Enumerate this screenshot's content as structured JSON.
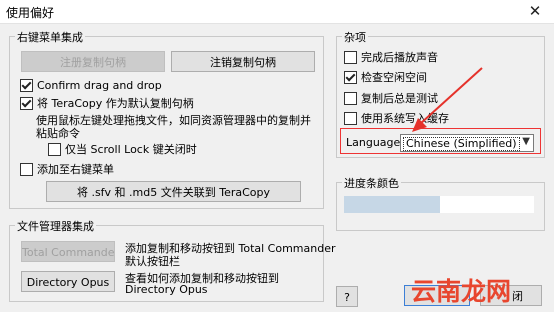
{
  "window": {
    "title": "使用偏好",
    "close_glyph": "✕"
  },
  "left": {
    "context_group": {
      "title": "右键菜单集成",
      "register_button": "注册复制句柄",
      "unregister_button": "注销复制句柄",
      "confirm_drag_label": "Confirm drag and drop",
      "confirm_drag_checked": true,
      "default_handler_label": "将 TeraCopy 作为默认复制句柄",
      "default_handler_checked": true,
      "default_handler_desc_1": "使用鼠标左键处理拖拽文件，如同资源管理器中的复制并",
      "default_handler_desc_2": "粘贴命令",
      "scroll_lock_label": "仅当 Scroll Lock 键关闭时",
      "scroll_lock_checked": false,
      "add_context_label": "添加至右键菜单",
      "add_context_checked": false,
      "associate_button": "将 .sfv 和 .md5 文件关联到 TeraCopy"
    },
    "fm_group": {
      "title": "文件管理器集成",
      "tc_button": "Total Commander",
      "tc_desc_1": "添加复制和移动按钮到 Total Commander",
      "tc_desc_2": "默认按钮栏",
      "dopus_button": "Directory Opus",
      "dopus_desc_1": "查看如何添加复制和移动按钮到",
      "dopus_desc_2": "Directory Opus"
    }
  },
  "right": {
    "misc_group": {
      "title": "杂项",
      "items": [
        {
          "label": "完成后播放声音",
          "checked": false
        },
        {
          "label": "检查空闲空间",
          "checked": true
        },
        {
          "label": "复制后总是测试",
          "checked": false
        },
        {
          "label": "使用系统写入缓存",
          "checked": false
        }
      ],
      "language_label": "Language:",
      "language_value": "Chinese (Simplified)"
    },
    "progress_group": {
      "title": "进度条颜色",
      "colors": [
        "#c6d7e6",
        "#ffffff"
      ]
    },
    "help_button": "?",
    "close_partial": "闭"
  },
  "annotations": {
    "arrow_color": "#e5322b",
    "box_color": "#e5322b"
  },
  "watermark": {
    "text": "云南龙网"
  }
}
